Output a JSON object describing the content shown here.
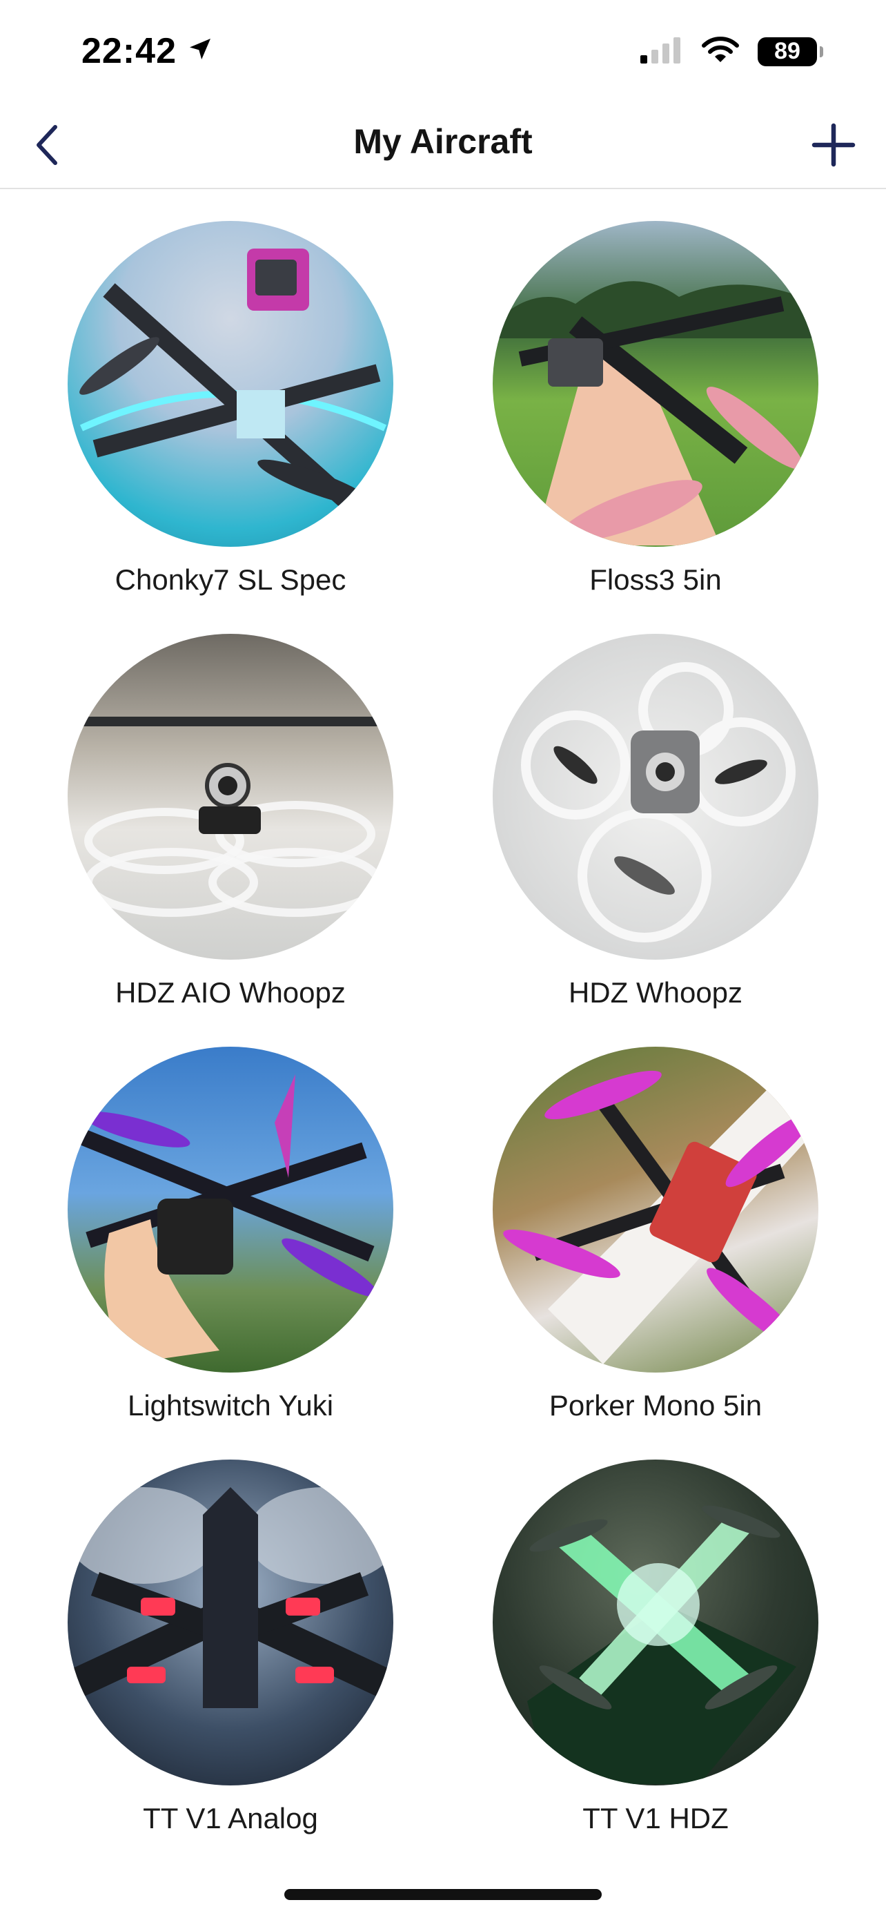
{
  "status_bar": {
    "time": "22:42",
    "battery": "89",
    "icons": [
      "location-arrow-icon",
      "cellular-signal-icon",
      "wifi-icon",
      "battery-icon"
    ]
  },
  "nav": {
    "title": "My Aircraft",
    "back_icon": "chevron-left-icon",
    "add_icon": "plus-icon",
    "accent_color": "#1e2759"
  },
  "aircraft": [
    {
      "name": "Chonky7 SL Spec"
    },
    {
      "name": "Floss3 5in"
    },
    {
      "name": "HDZ AIO Whoopz"
    },
    {
      "name": "HDZ Whoopz"
    },
    {
      "name": "Lightswitch Yuki"
    },
    {
      "name": "Porker Mono 5in"
    },
    {
      "name": "TT V1 Analog"
    },
    {
      "name": "TT V1 HDZ"
    }
  ]
}
